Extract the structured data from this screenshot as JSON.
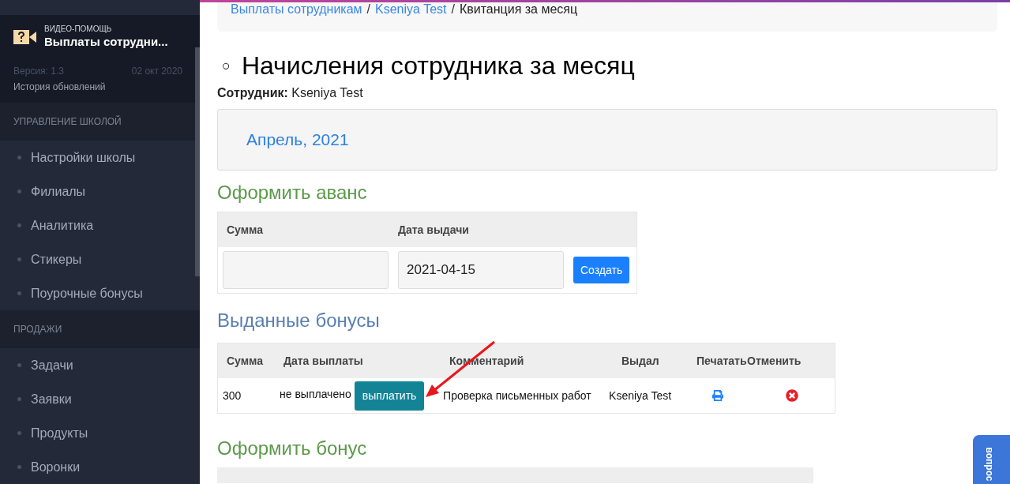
{
  "sidebar": {
    "help": {
      "label": "ВИДЕО-ПОМОЩЬ",
      "title": "Выплаты сотрудни...",
      "version": "Версия: 1.3",
      "date": "02 окт 2020",
      "history": "История обновлений"
    },
    "sections": [
      {
        "label": "УПРАВЛЕНИЕ ШКОЛОЙ",
        "items": [
          "Настройки школы",
          "Филиалы",
          "Аналитика",
          "Стикеры",
          "Поурочные бонусы"
        ]
      },
      {
        "label": "ПРОДАЖИ",
        "items": [
          "Задачи",
          "Заявки",
          "Продукты",
          "Воронки"
        ]
      }
    ]
  },
  "breadcrumb_separator": "/",
  "breadcrumb": [
    {
      "label": "Выплаты сотрудникам",
      "link": true
    },
    {
      "label": "Kseniya Test",
      "link": true
    },
    {
      "label": "Квитанция за месяц",
      "link": false
    }
  ],
  "heading": {
    "bullet": "○",
    "title": "Начисления сотрудника за месяц"
  },
  "employee": "**Сотрудник:** Kseniya Test",
  "month": "Апрель, 2021",
  "advance": {
    "title": "Оформить аванс",
    "columns": [
      "Сумма",
      "Дата выдачи"
    ],
    "date_value": "2021-04-15",
    "button": "Создать"
  },
  "bonuses": {
    "title": "Выданные бонусы",
    "columns": [
      "Сумма",
      "Дата выплаты",
      "Комментарий",
      "Выдал",
      "Печатать",
      "Отменить"
    ],
    "rows": [
      {
        "amount": "300",
        "status": "не выплачено",
        "pay_button": "выплатить",
        "comment": "Проверка письменных работ",
        "issuer": "Kseniya Test"
      }
    ]
  },
  "new_bonus": {
    "title": "Оформить бонус"
  },
  "feedback_tab": "вопрос"
}
